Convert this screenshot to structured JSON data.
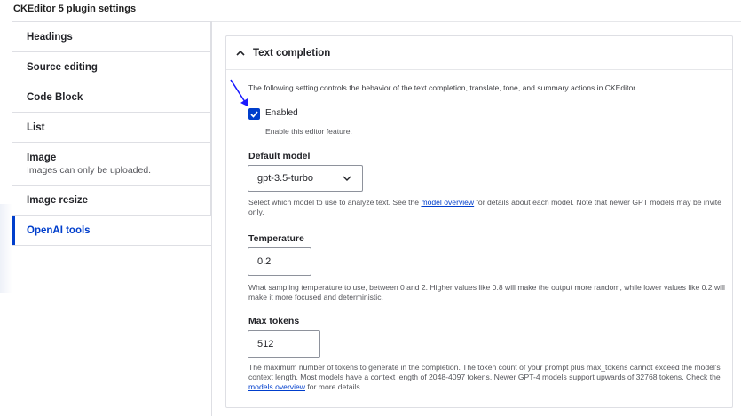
{
  "page_title": "CKEditor 5 plugin settings",
  "vertical_tabs": [
    {
      "title": "Headings",
      "subtitle": ""
    },
    {
      "title": "Source editing",
      "subtitle": ""
    },
    {
      "title": "Code Block",
      "subtitle": ""
    },
    {
      "title": "List",
      "subtitle": ""
    },
    {
      "title": "Image",
      "subtitle": "Images can only be uploaded."
    },
    {
      "title": "Image resize",
      "subtitle": ""
    },
    {
      "title": "OpenAI tools",
      "subtitle": "",
      "active": true
    }
  ],
  "details": {
    "summary": "Text completion",
    "expanded": true,
    "description": "The following setting controls the behavior of the text completion, translate, tone, and summary actions in CKEditor.",
    "enabled": {
      "label": "Enabled",
      "checked": true,
      "description": "Enable this editor feature."
    },
    "default_model": {
      "label": "Default model",
      "value": "gpt-3.5-turbo",
      "help_before": "Select which model to use to analyze text. See the ",
      "help_link": "model overview",
      "help_after": " for details about each model. Note that newer GPT models may be invite only."
    },
    "temperature": {
      "label": "Temperature",
      "value": "0.2",
      "help": "What sampling temperature to use, between 0 and 2. Higher values like 0.8 will make the output more random, while lower values like 0.2 will make it more focused and deterministic."
    },
    "max_tokens": {
      "label": "Max tokens",
      "value": "512",
      "help_before": "The maximum number of tokens to generate in the completion. The token count of your prompt plus max_tokens cannot exceed the model's context length. Most models have a context length of 2048-4097 tokens. Newer GPT-4 models support upwards of 32768 tokens. Check the ",
      "help_link": "models overview",
      "help_after": " for more details."
    }
  },
  "colors": {
    "accent": "#003ecc",
    "annotation_arrow": "#1a1aff",
    "border": "#dedfe4",
    "text": "#232429"
  }
}
